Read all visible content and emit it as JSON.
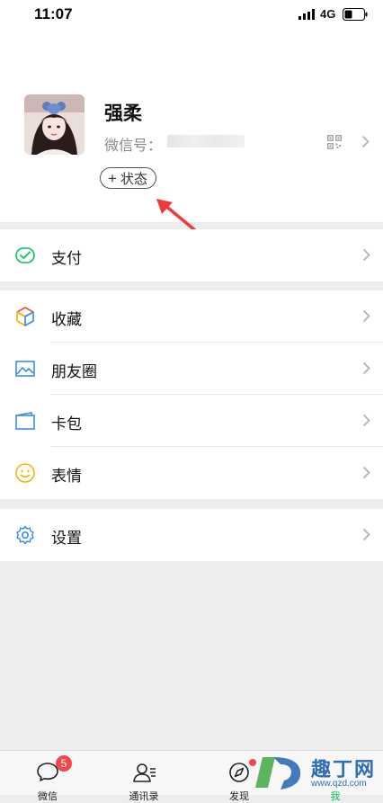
{
  "status_bar": {
    "time": "11:07",
    "network": "4G"
  },
  "profile": {
    "name": "强柔",
    "wechat_id_label": "微信号：",
    "status_button_label": "状态",
    "status_button_plus": "+"
  },
  "menu": {
    "pay": "支付",
    "favorites": "收藏",
    "moments": "朋友圈",
    "cards": "卡包",
    "stickers": "表情",
    "settings": "设置"
  },
  "tabbar": {
    "chats": "微信",
    "chats_badge": "5",
    "contacts": "通讯录",
    "discover": "发现",
    "me": "我"
  },
  "watermark": {
    "text": "趣丁网",
    "url": "www.qzd.com"
  },
  "colors": {
    "accent": "#07c160",
    "badge": "#f04848",
    "background": "#ededed"
  }
}
